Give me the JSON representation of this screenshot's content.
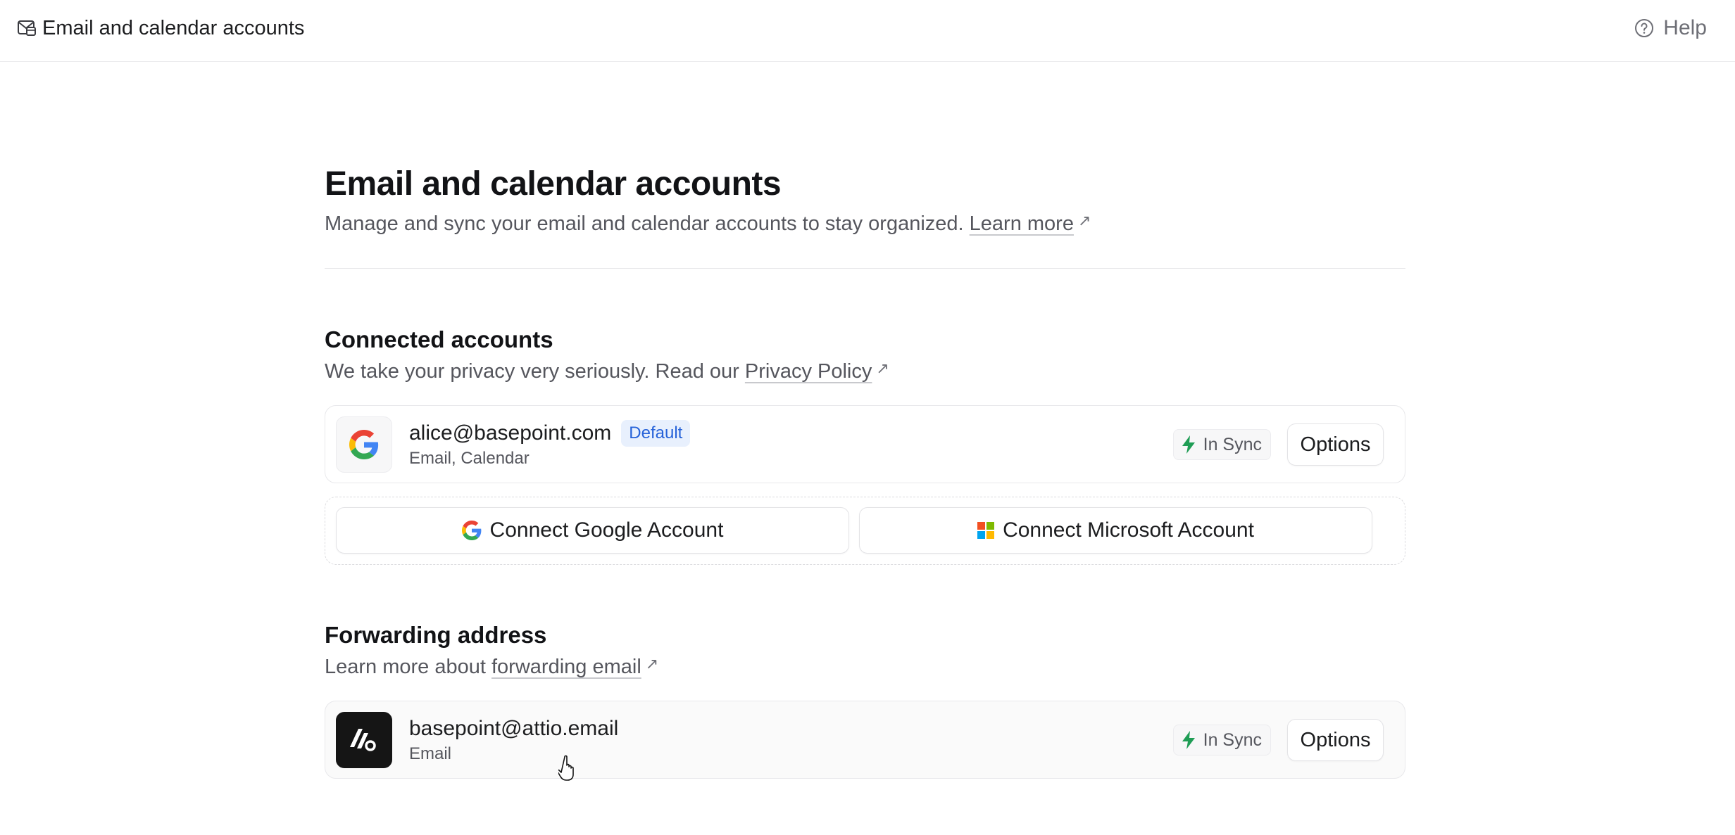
{
  "topbar": {
    "title": "Email and calendar accounts",
    "help_label": "Help",
    "icon": "mail-calendar-icon"
  },
  "page": {
    "title": "Email and calendar accounts",
    "subtitle": "Manage and sync your email and calendar accounts to stay organized.",
    "learn_more": "Learn more",
    "external_arrow": "↗"
  },
  "connected": {
    "title": "Connected accounts",
    "subtitle": "We take your privacy very seriously. Read our",
    "privacy_link": "Privacy Policy",
    "accounts": [
      {
        "email": "alice@basepoint.com",
        "badge": "Default",
        "meta": "Email, Calendar",
        "provider_icon": "google-icon",
        "status": "In Sync",
        "options_label": "Options"
      }
    ],
    "connect_google": "Connect Google Account",
    "connect_microsoft": "Connect Microsoft Account"
  },
  "forwarding": {
    "title": "Forwarding address",
    "subtitle": "Learn more about",
    "link": "forwarding email",
    "address": {
      "email": "basepoint@attio.email",
      "meta": "Email",
      "provider_icon": "attio-logo-icon",
      "status": "In Sync",
      "options_label": "Options"
    }
  },
  "colors": {
    "sync_green": "#1f9d55",
    "badge_bg": "#e8f0fd",
    "badge_text": "#2662d9",
    "google_blue": "#4285F4",
    "google_red": "#EA4335",
    "google_yellow": "#FBBC05",
    "google_green": "#34A853",
    "ms_red": "#F25022",
    "ms_green": "#7FBA00",
    "ms_blue": "#00A4EF",
    "ms_yellow": "#FFB900"
  }
}
